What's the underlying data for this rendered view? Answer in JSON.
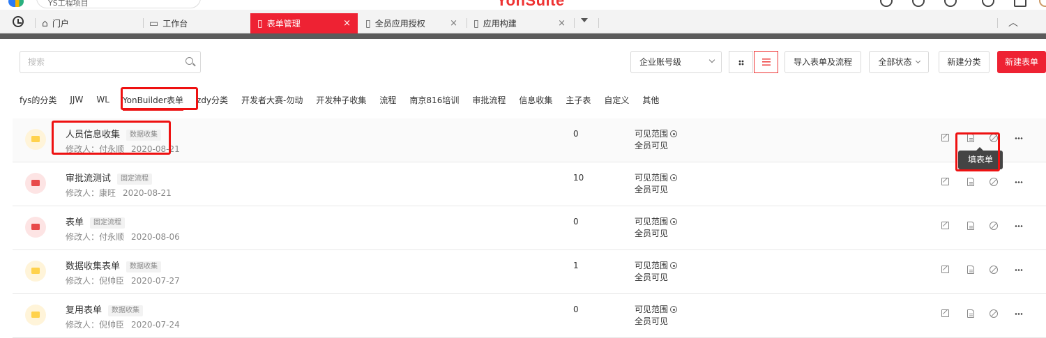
{
  "brand": "YonSuite",
  "top_search_text": "YS工程项目",
  "tabs": [
    {
      "label": "门户",
      "icon": "home-icon"
    },
    {
      "label": "工作台",
      "icon": "monitor-icon"
    },
    {
      "label": "表单管理",
      "icon": "document-icon",
      "active": true
    },
    {
      "label": "全员应用授权",
      "icon": "document-icon"
    },
    {
      "label": "应用构建",
      "icon": "document-icon"
    }
  ],
  "toolbar": {
    "search_placeholder": "搜索",
    "account_level": "企业账号级",
    "import_label": "导入表单及流程",
    "status_label": "全部状态",
    "new_category_label": "新建分类",
    "new_form_label": "新建表单"
  },
  "categories": [
    "fys的分类",
    "JJW",
    "WL",
    "YonBuilder表单",
    "zdy分类",
    "开发者大赛-勿动",
    "开发种子收集",
    "流程",
    "南京816培训",
    "审批流程",
    "信息收集",
    "主子表",
    "自定义",
    "其他"
  ],
  "active_category": "YonBuilder表单",
  "rows": [
    {
      "title": "人员信息收集",
      "badge": "数据收集",
      "modifier_label": "修改人：付永顺",
      "date": "2020-08-21",
      "count": "0",
      "visibility_label": "可见范围",
      "visibility_value": "全员可见",
      "folder_color": "#ffd24d",
      "folder_bg": "#fff4d9"
    },
    {
      "title": "审批流测试",
      "badge": "固定流程",
      "modifier_label": "修改人：康旺",
      "date": "2020-08-21",
      "count": "10",
      "visibility_label": "可见范围",
      "visibility_value": "全员可见",
      "folder_color": "#e84a4a",
      "folder_bg": "#fde4e4"
    },
    {
      "title": "表单",
      "badge": "固定流程",
      "modifier_label": "修改人：付永顺",
      "date": "2020-08-06",
      "count": "0",
      "visibility_label": "可见范围",
      "visibility_value": "全员可见",
      "folder_color": "#e84a4a",
      "folder_bg": "#fde4e4"
    },
    {
      "title": "数据收集表单",
      "badge": "数据收集",
      "modifier_label": "修改人：倪帅臣",
      "date": "2020-07-27",
      "count": "1",
      "visibility_label": "可见范围",
      "visibility_value": "全员可见",
      "folder_color": "#ffd24d",
      "folder_bg": "#fff4d9"
    },
    {
      "title": "复用表单",
      "badge": "数据收集",
      "modifier_label": "修改人：倪帅臣",
      "date": "2020-07-24",
      "count": "0",
      "visibility_label": "可见范围",
      "visibility_value": "全员可见",
      "folder_color": "#ffd24d",
      "folder_bg": "#fff4d9"
    }
  ],
  "tooltip": "填表单",
  "colors": {
    "accent": "#ee2233",
    "highlight": "#ee1111"
  }
}
